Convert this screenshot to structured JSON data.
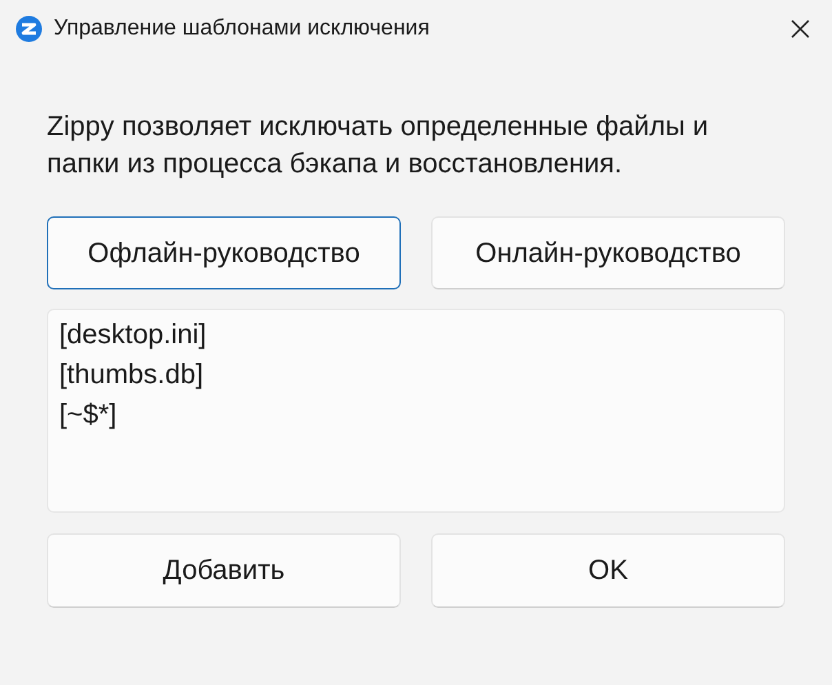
{
  "window": {
    "title": "Управление шаблонами исключения"
  },
  "description": "Zippy позволяет исключать определенные файлы и папки из процесса бэкапа и восстановления.",
  "guide_buttons": [
    {
      "label": "Офлайн-руководство",
      "focused": true
    },
    {
      "label": "Онлайн-руководство",
      "focused": false
    }
  ],
  "patterns": [
    "[desktop.ini]",
    "[thumbs.db]",
    "[~$*]"
  ],
  "buttons": [
    "Добавить",
    "OK"
  ]
}
